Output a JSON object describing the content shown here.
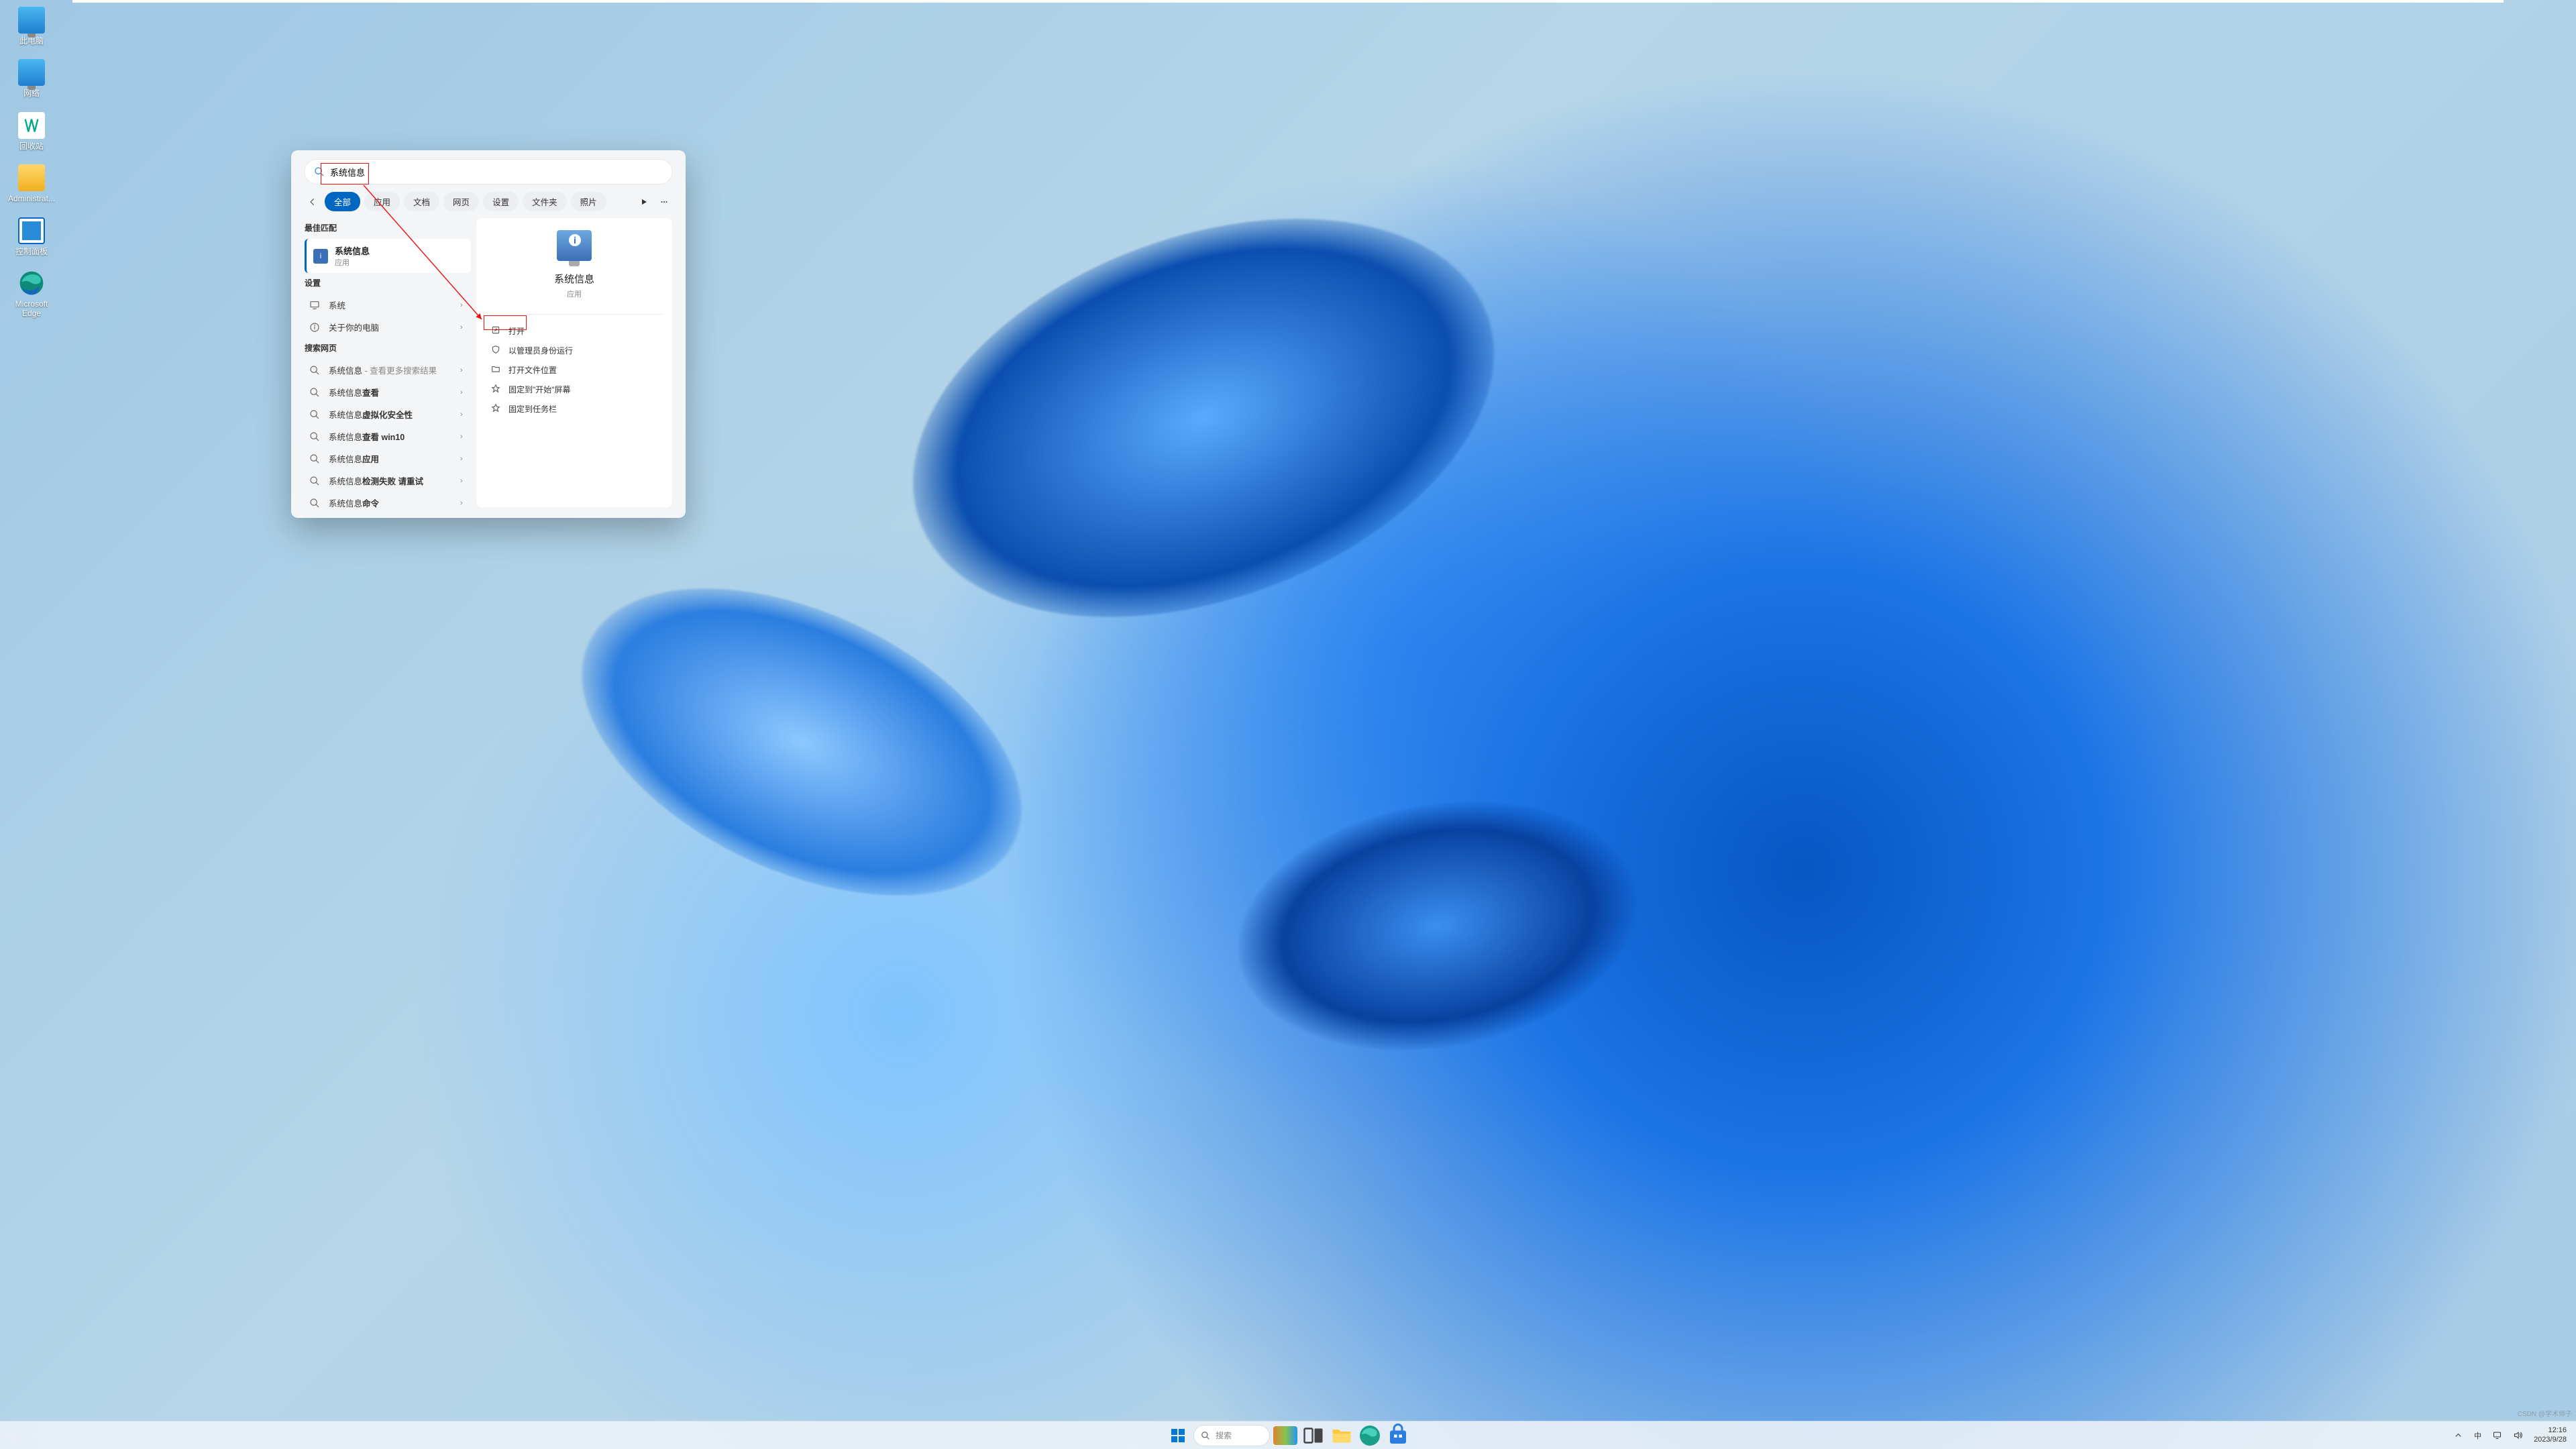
{
  "desktop": {
    "icons": [
      {
        "label": "此电脑",
        "kind": "computer"
      },
      {
        "label": "网络",
        "kind": "computer"
      },
      {
        "label": "回收站",
        "kind": "recycle"
      },
      {
        "label": "Administrat...",
        "kind": "folder"
      },
      {
        "label": "控制面板",
        "kind": "panel"
      },
      {
        "label": "Microsoft Edge",
        "kind": "edge"
      }
    ]
  },
  "search": {
    "query": "系统信息",
    "tabs": [
      "全部",
      "应用",
      "文档",
      "网页",
      "设置",
      "文件夹",
      "照片"
    ],
    "active_tab": 0,
    "sections": {
      "best_match_label": "最佳匹配",
      "best_match": {
        "title": "系统信息",
        "subtitle": "应用"
      },
      "settings_label": "设置",
      "settings_items": [
        {
          "icon": "monitor",
          "text": "系统"
        },
        {
          "icon": "info",
          "text": "关于你的电脑"
        }
      ],
      "web_label": "搜索网页",
      "web_items": [
        {
          "prefix": "系统信息",
          "suffix": " - 查看更多搜索结果",
          "fade": true
        },
        {
          "prefix": "系统信息",
          "suffix": "查看"
        },
        {
          "prefix": "系统信息",
          "suffix": "虚拟化安全性"
        },
        {
          "prefix": "系统信息",
          "suffix": "查看 win10"
        },
        {
          "prefix": "系统信息",
          "suffix": "应用"
        },
        {
          "prefix": "系统信息",
          "suffix": "检测失败 请重试"
        },
        {
          "prefix": "系统信息",
          "suffix": "命令"
        }
      ]
    },
    "preview": {
      "title": "系统信息",
      "subtitle": "应用",
      "actions": [
        {
          "icon": "open",
          "label": "打开"
        },
        {
          "icon": "shield",
          "label": "以管理员身份运行"
        },
        {
          "icon": "folder",
          "label": "打开文件位置"
        },
        {
          "icon": "pin",
          "label": "固定到\"开始\"屏幕"
        },
        {
          "icon": "pin",
          "label": "固定到任务栏"
        }
      ]
    }
  },
  "taskbar": {
    "search_placeholder": "搜索",
    "ime": "中",
    "time": "12:16",
    "date": "2023/9/28"
  },
  "watermark": "CSDN @学术师子"
}
